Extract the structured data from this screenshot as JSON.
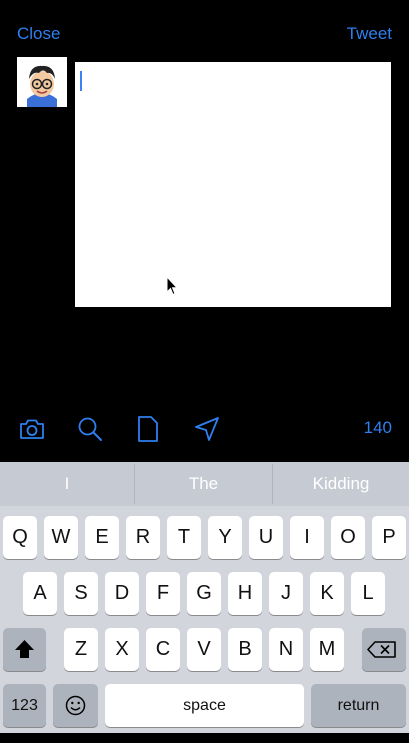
{
  "header": {
    "close_label": "Close",
    "tweet_label": "Tweet"
  },
  "toolbar": {
    "char_count": "140",
    "icons": [
      "camera-icon",
      "search-icon",
      "document-icon",
      "location-icon"
    ]
  },
  "suggestions": [
    "I",
    "The",
    "Kidding"
  ],
  "keyboard": {
    "row1": [
      "Q",
      "W",
      "E",
      "R",
      "T",
      "Y",
      "U",
      "I",
      "O",
      "P"
    ],
    "row2": [
      "A",
      "S",
      "D",
      "F",
      "G",
      "H",
      "J",
      "K",
      "L"
    ],
    "row3": [
      "Z",
      "X",
      "C",
      "V",
      "B",
      "N",
      "M"
    ],
    "numbers_label": "123",
    "space_label": "space",
    "return_label": "return"
  },
  "colors": {
    "accent": "#2f7ff0",
    "background": "#000000"
  }
}
